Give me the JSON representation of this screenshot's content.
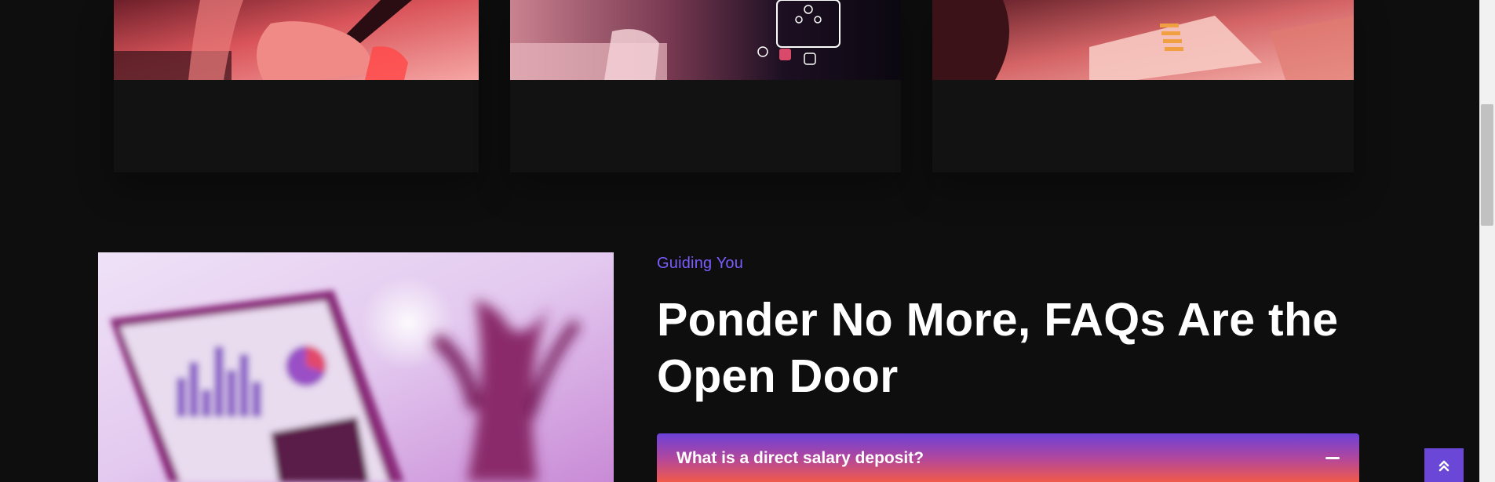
{
  "cards": [
    {
      "image": "hand-holding-tablet-photo"
    },
    {
      "image": "hand-touching-digital-interface-photo"
    },
    {
      "image": "business-documents-chart-photo"
    }
  ],
  "faq_section": {
    "image": "laptop-analytics-dashboard-photo",
    "eyebrow": "Guiding You",
    "heading": "Ponder No More, FAQs Are the Open Door",
    "items": [
      {
        "question": "What is a direct salary deposit?",
        "expanded": true,
        "toggle_icon": "minus-icon"
      }
    ]
  },
  "back_to_top": {
    "icon": "double-chevron-up-icon"
  },
  "colors": {
    "background": "#0e0e0e",
    "accent": "#7b5cff",
    "gradient_top": "#6b42d9",
    "gradient_bottom": "#f15a4a",
    "back_to_top_bg": "#6b47d8"
  }
}
